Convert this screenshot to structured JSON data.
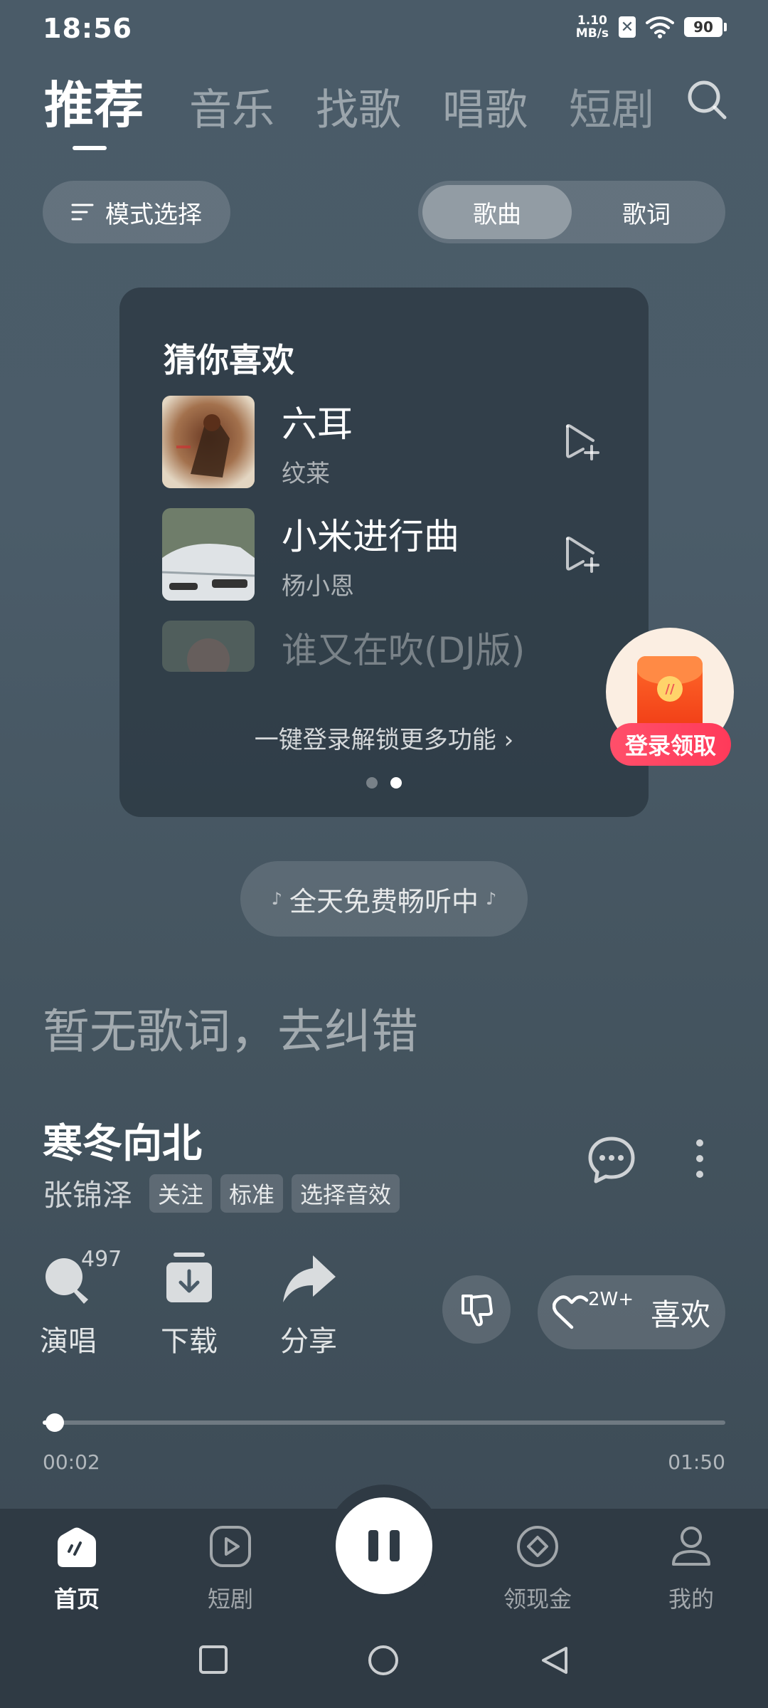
{
  "status": {
    "time": "18:56",
    "net_speed_value": "1.10",
    "net_speed_unit": "MB/s",
    "battery": "90"
  },
  "tabs": [
    {
      "label": "推荐",
      "active": true
    },
    {
      "label": "音乐",
      "active": false
    },
    {
      "label": "找歌",
      "active": false
    },
    {
      "label": "唱歌",
      "active": false
    },
    {
      "label": "短剧",
      "active": false
    }
  ],
  "mode_select": "模式选择",
  "segment": {
    "songs": "歌曲",
    "lyrics": "歌词",
    "selected": "歌曲"
  },
  "recommend_card": {
    "title": "猜你喜欢",
    "songs": [
      {
        "name": "六耳",
        "artist": "纹莱"
      },
      {
        "name": "小米进行曲",
        "artist": "杨小恩"
      },
      {
        "name": "谁又在吹(DJ版)",
        "artist": ""
      }
    ],
    "login_link": "一键登录解锁更多功能",
    "page": "2/2"
  },
  "promo": {
    "label": "登录领取"
  },
  "free_listen": "全天免费畅听中",
  "no_lyrics": "暂无歌词，去纠错",
  "now_playing": {
    "title": "寒冬向北",
    "artist": "张锦泽",
    "tags": [
      "关注",
      "标准",
      "选择音效"
    ],
    "sing_count": "497",
    "like_count": "2W+",
    "current_time": "00:02",
    "total_time": "01:50",
    "progress": 0.018
  },
  "actions": {
    "sing": "演唱",
    "download": "下载",
    "share": "分享",
    "like": "喜欢"
  },
  "bottom_nav": [
    {
      "label": "首页",
      "active": true
    },
    {
      "label": "短剧",
      "active": false
    },
    {
      "label": "领现金",
      "active": false
    },
    {
      "label": "我的",
      "active": false
    }
  ],
  "colors": {
    "bg": "#4a5b68",
    "nav_bg": "#2f3a44",
    "promo_red": "#ff3a5a"
  }
}
